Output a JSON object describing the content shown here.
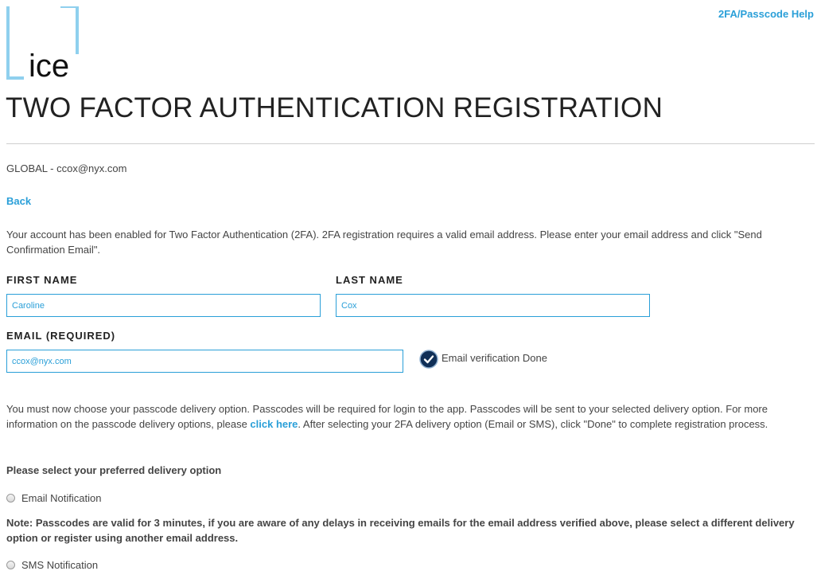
{
  "header": {
    "logo_text": "ice",
    "help_link": "2FA/Passcode Help",
    "title": "TWO FACTOR AUTHENTICATION REGISTRATION"
  },
  "account": {
    "line": "GLOBAL - ccox@nyx.com"
  },
  "nav": {
    "back_label": "Back"
  },
  "intro": {
    "text": "Your account has been enabled for Two Factor Authentication (2FA). 2FA registration requires a valid email address. Please enter your email address and click \"Send Confirmation Email\"."
  },
  "form": {
    "first_name_label": "FIRST NAME",
    "first_name_value": "Caroline",
    "last_name_label": "LAST NAME",
    "last_name_value": "Cox",
    "email_label": "EMAIL (REQUIRED)",
    "email_value": "ccox@nyx.com",
    "verification_status": "Email verification Done"
  },
  "delivery": {
    "text_before_link": "You must now choose your passcode delivery option. Passcodes will be required for login to the app. Passcodes will be sent to your selected delivery option. For more information on the passcode delivery options, please ",
    "link_label": "click here",
    "text_after_link": ". After selecting your 2FA delivery option (Email or SMS), click \"Done\" to complete registration process.",
    "select_heading": "Please select your preferred delivery option",
    "options": [
      {
        "label": "Email Notification",
        "selected": false
      },
      {
        "label": "SMS Notification",
        "selected": false
      }
    ],
    "note": "Note: Passcodes are valid for 3 minutes, if you are aware of any delays in receiving emails for the email address verified above, please select a different delivery option or register using another email address."
  },
  "colors": {
    "accent": "#2a9fd8",
    "logo_bracket": "#8fd0ee",
    "verify_badge": "#0f2f57"
  },
  "icons": {
    "logo": "ice-logo-icon",
    "verified": "check-circle-icon"
  }
}
